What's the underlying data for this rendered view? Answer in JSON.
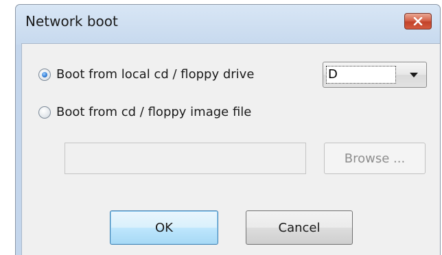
{
  "window": {
    "title": "Network boot"
  },
  "options": {
    "local_drive": {
      "label": "Boot from local cd / floppy drive",
      "selected": true
    },
    "image_file": {
      "label": "Boot from cd / floppy image file",
      "selected": false
    }
  },
  "drive_select": {
    "value": "D"
  },
  "image_path": {
    "value": ""
  },
  "buttons": {
    "browse": "Browse ...",
    "ok": "OK",
    "cancel": "Cancel"
  },
  "colors": {
    "close_button": "#d6644c",
    "ok_button_border": "#3c7fb1",
    "titlebar": "#d8e6f5"
  },
  "icons": {
    "close": "close-icon",
    "dropdown": "chevron-down-icon"
  }
}
